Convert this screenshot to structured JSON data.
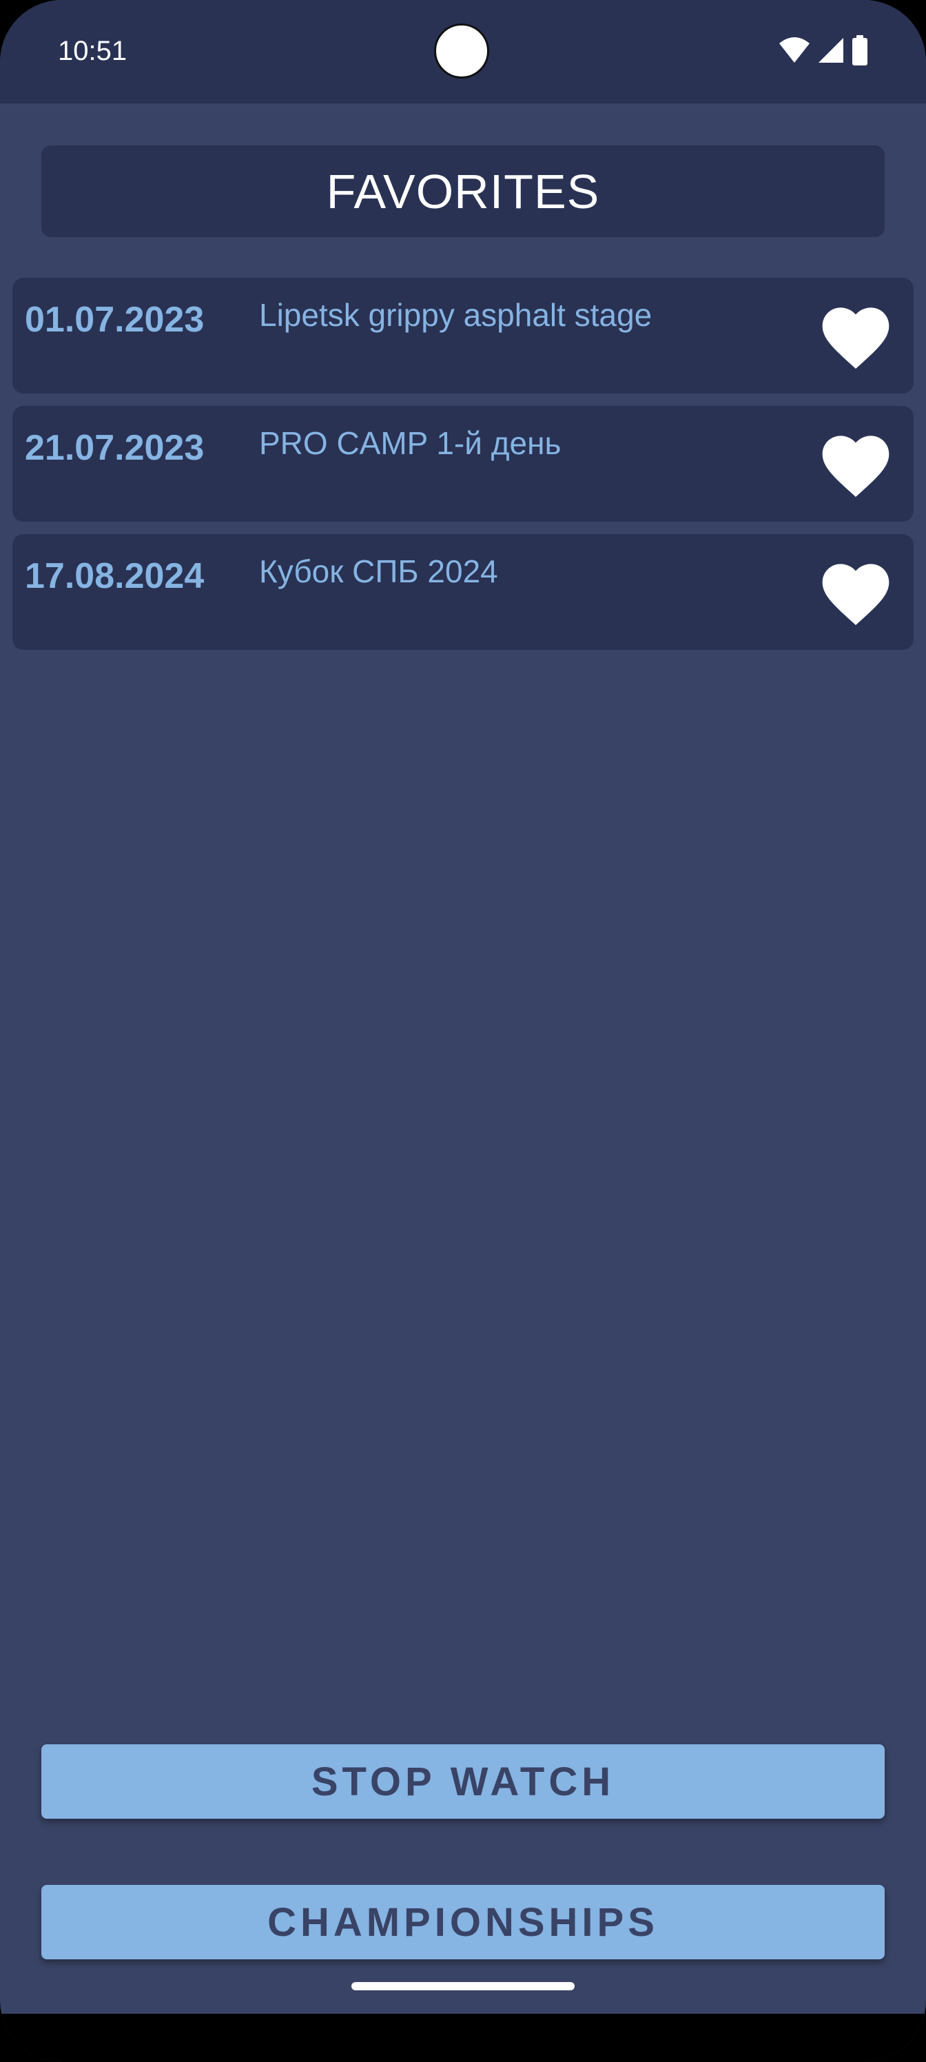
{
  "status_bar": {
    "time": "10:51",
    "icons": [
      "wifi-icon",
      "signal-icon",
      "battery-icon"
    ]
  },
  "header": {
    "title": "FAVORITES"
  },
  "favorites": [
    {
      "date": "01.07.2023",
      "title": "Lipetsk grippy asphalt stage",
      "favorited": true
    },
    {
      "date": "21.07.2023",
      "title": "PRO CAMP 1-й день",
      "favorited": true
    },
    {
      "date": "17.08.2024",
      "title": "Кубок СПБ 2024",
      "favorited": true
    }
  ],
  "buttons": {
    "stopwatch_label": "STOP WATCH",
    "championships_label": "CHAMPIONSHIPS"
  },
  "colors": {
    "background": "#394365",
    "surface": "#293253",
    "accent": "#86b4e3",
    "heart": "#ffffff"
  }
}
